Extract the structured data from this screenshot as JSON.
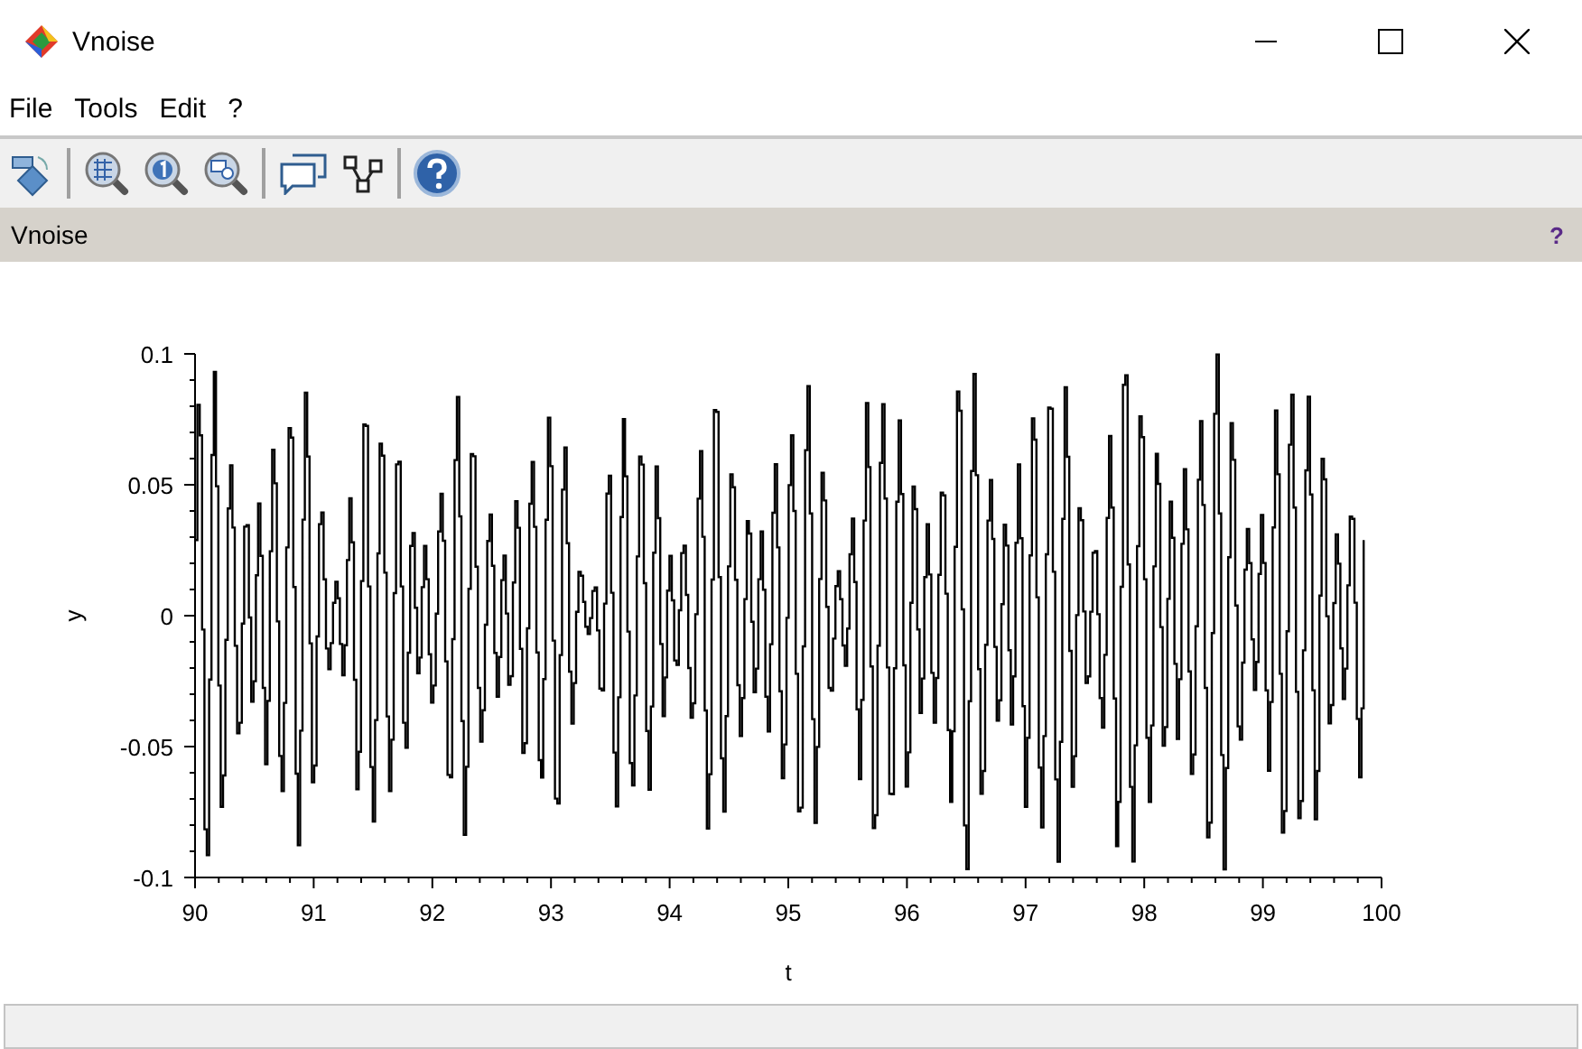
{
  "window": {
    "title": "Vnoise"
  },
  "menu": [
    "File",
    "Tools",
    "Edit",
    "?"
  ],
  "toolbar": [
    {
      "kind": "rotate"
    },
    {
      "kind": "sep"
    },
    {
      "kind": "zoom-grid"
    },
    {
      "kind": "zoom-one"
    },
    {
      "kind": "zoom-box"
    },
    {
      "kind": "sep"
    },
    {
      "kind": "bubbles"
    },
    {
      "kind": "nodes"
    },
    {
      "kind": "sep"
    },
    {
      "kind": "help"
    }
  ],
  "panel": {
    "title": "Vnoise",
    "help": "?"
  },
  "plot": {
    "xlabel": "t",
    "ylabel": "y",
    "xticks": [
      "90",
      "91",
      "92",
      "93",
      "94",
      "95",
      "96",
      "97",
      "98",
      "99",
      "100"
    ],
    "yticks": [
      "0.1",
      "0.05",
      "0",
      "-0.05",
      "-0.1"
    ]
  }
}
